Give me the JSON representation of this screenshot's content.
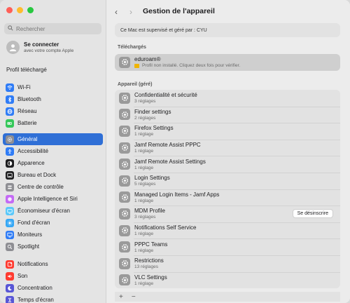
{
  "window": {
    "traffic_lights": [
      "#ff5f57",
      "#febc2e",
      "#28c840"
    ]
  },
  "sidebar": {
    "search_placeholder": "Rechercher",
    "account": {
      "title": "Se connecter",
      "subtitle": "avec votre compte Apple"
    },
    "profile_downloaded": "Profil téléchargé",
    "groups": [
      [
        {
          "label": "Wi-Fi",
          "icon": "wifi-icon",
          "color": "#2f7cf6"
        },
        {
          "label": "Bluetooth",
          "icon": "bluetooth-icon",
          "color": "#2f7cf6"
        },
        {
          "label": "Réseau",
          "icon": "globe-icon",
          "color": "#2f7cf6"
        },
        {
          "label": "Batterie",
          "icon": "battery-icon",
          "color": "#34c759"
        }
      ],
      [
        {
          "label": "Général",
          "icon": "gear-icon",
          "color": "#8e8e93",
          "active": true
        },
        {
          "label": "Accessibilité",
          "icon": "accessibility-icon",
          "color": "#2f7cf6"
        },
        {
          "label": "Apparence",
          "icon": "appearance-icon",
          "color": "#1d1d1f"
        },
        {
          "label": "Bureau et Dock",
          "icon": "dock-icon",
          "color": "#1d1d1f"
        },
        {
          "label": "Centre de contrôle",
          "icon": "control-center-icon",
          "color": "#8e8e93"
        },
        {
          "label": "Apple Intelligence et Siri",
          "icon": "siri-icon",
          "color": "#c46af5"
        },
        {
          "label": "Économiseur d'écran",
          "icon": "screensaver-icon",
          "color": "#5ac8fa"
        },
        {
          "label": "Fond d'écran",
          "icon": "wallpaper-icon",
          "color": "#35a7f5"
        },
        {
          "label": "Moniteurs",
          "icon": "display-icon",
          "color": "#2f7cf6"
        },
        {
          "label": "Spotlight",
          "icon": "spotlight-icon",
          "color": "#8e8e93"
        }
      ],
      [
        {
          "label": "Notifications",
          "icon": "notifications-icon",
          "color": "#ff3b30"
        },
        {
          "label": "Son",
          "icon": "sound-icon",
          "color": "#ff3b30"
        },
        {
          "label": "Concentration",
          "icon": "focus-icon",
          "color": "#5856d6"
        },
        {
          "label": "Temps d'écran",
          "icon": "screen-time-icon",
          "color": "#5856d6"
        }
      ]
    ]
  },
  "toolbar": {
    "back": "‹",
    "forward": "›",
    "title": "Gestion de l'appareil"
  },
  "main": {
    "supervised_note": "Ce Mac est supervisé et géré par : CYU",
    "downloaded_section": "Téléchargés",
    "downloaded": {
      "title": "eduroam®",
      "subtitle": "Profil non installé. Cliquez deux fois pour vérifier."
    },
    "managed_section": "Appareil (géré)",
    "unenroll_label": "Se désinscrire",
    "profiles": [
      {
        "title": "Confidentialité et sécurité",
        "subtitle": "3 réglages"
      },
      {
        "title": "Finder settings",
        "subtitle": "2 réglages"
      },
      {
        "title": "Firefox Settings",
        "subtitle": "1 réglage"
      },
      {
        "title": "Jamf Remote Assist PPPC",
        "subtitle": "1 réglage"
      },
      {
        "title": "Jamf Remote Assist Settings",
        "subtitle": "1 réglage"
      },
      {
        "title": "Login Settings",
        "subtitle": "5 réglages"
      },
      {
        "title": "Managed Login Items - Jamf Apps",
        "subtitle": "1 réglage"
      },
      {
        "title": "MDM Profile",
        "subtitle": "3 réglages",
        "has_unenroll": true
      },
      {
        "title": "Notifications Self Service",
        "subtitle": "1 réglage"
      },
      {
        "title": "PPPC Teams",
        "subtitle": "1 réglage"
      },
      {
        "title": "Restrictions",
        "subtitle": "13 réglages"
      },
      {
        "title": "VLC Settings",
        "subtitle": "1 réglage"
      }
    ],
    "add_label": "+",
    "remove_label": "−"
  }
}
